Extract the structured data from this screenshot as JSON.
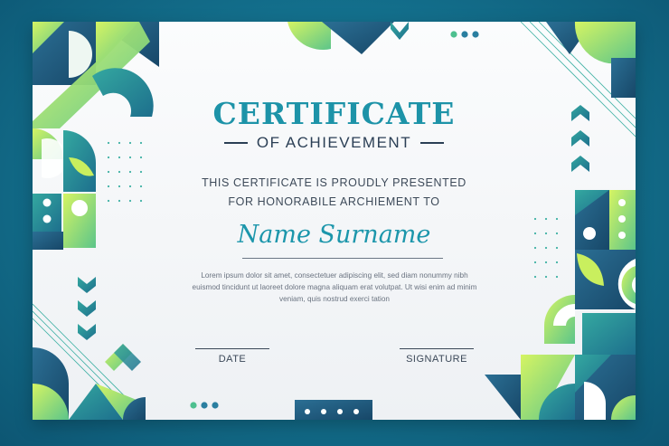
{
  "certificate": {
    "title": "CERTIFICATE",
    "subtitle": "OF ACHIEVEMENT",
    "presented_line1": "THIS CERTIFICATE IS PROUDLY PRESENTED",
    "presented_line2": "FOR HONORABILE ARCHIEMENT TO",
    "recipient_name": "Name Surname",
    "body_line1": "Lorem ipsum dolor sit amet, consectetuer adipiscing elit, sed diam nonummy nibh",
    "body_line2": "euismod tincidunt ut laoreet dolore magna aliquam erat volutpat. Ut wisi enim ad minim",
    "body_line3": "veniam, quis nostrud exerci tation",
    "date_label": "DATE",
    "signature_label": "SIGNATURE"
  },
  "colors": {
    "background": "#136f8c",
    "teal_accent": "#1d93a8",
    "navy": "#1e4f74",
    "green": "#7fd37a",
    "lime": "#c9ef5e",
    "text_dark": "#2b3f55"
  }
}
